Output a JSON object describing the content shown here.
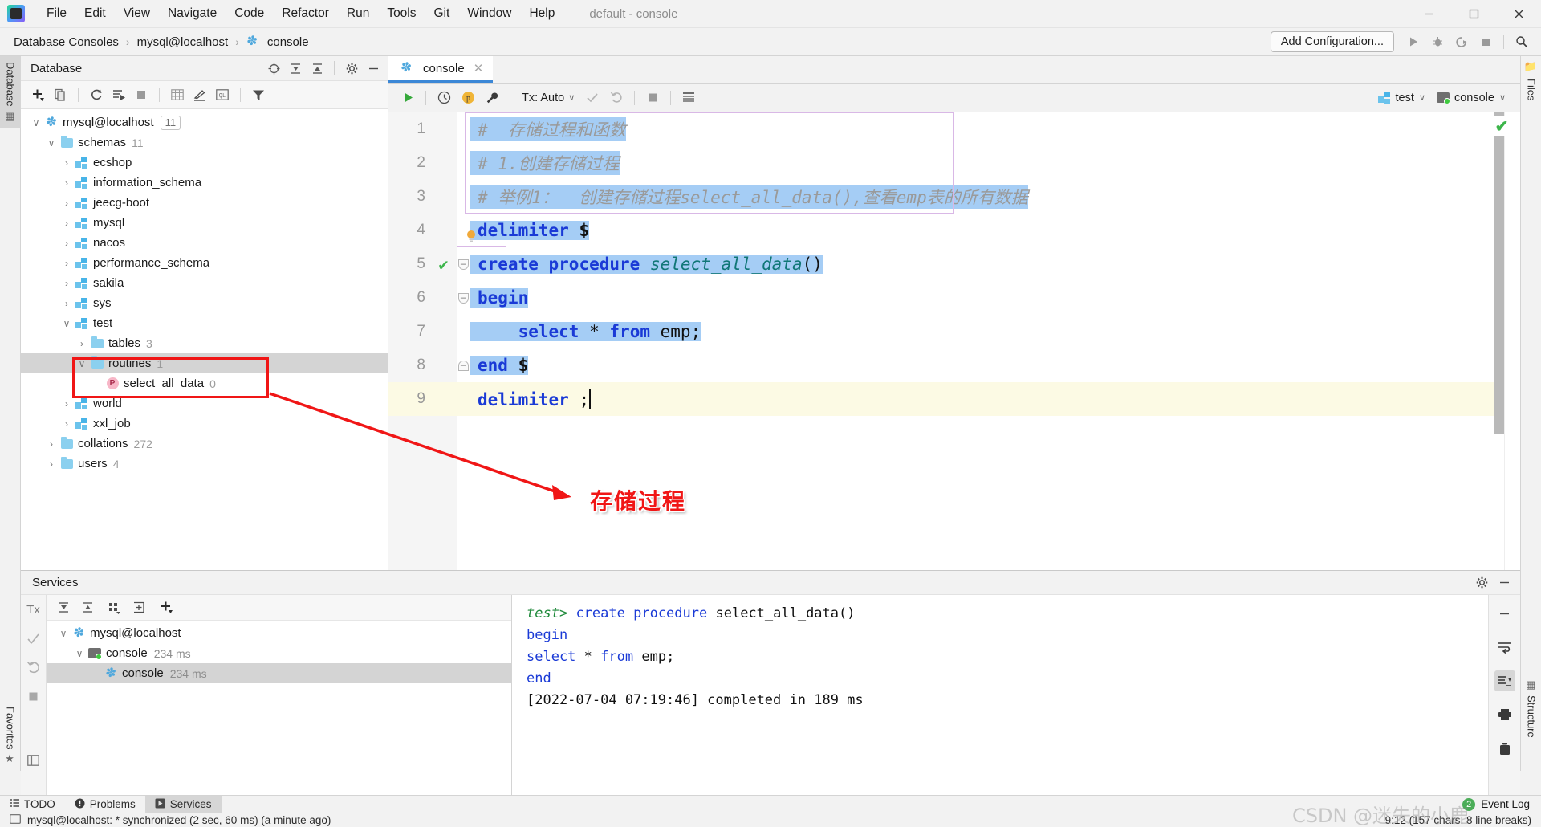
{
  "titlebar": {
    "app_icon": "datagrip-logo",
    "menus": [
      "File",
      "Edit",
      "View",
      "Navigate",
      "Code",
      "Refactor",
      "Run",
      "Tools",
      "Git",
      "Window",
      "Help"
    ],
    "window_title": "default - console",
    "minimize": "─",
    "maximize": "❐",
    "close": "✕"
  },
  "navbar": {
    "breadcrumbs": [
      "Database Consoles",
      "mysql@localhost",
      "console"
    ],
    "separator": "›",
    "add_configuration": "Add Configuration...",
    "icons": [
      "run-icon",
      "debug-icon",
      "run-with-coverage-icon",
      "stop-icon",
      "search-everywhere-icon"
    ]
  },
  "left_rail": {
    "database_tab": "Database",
    "favorites_tab": "Favorites"
  },
  "right_rail": {
    "files_tab": "Files",
    "structure_tab": "Structure"
  },
  "database_panel": {
    "title": "Database",
    "header_icons": [
      "sync-pointer-icon",
      "expand-all-icon",
      "collapse-all-icon",
      "gear-icon",
      "hide-icon"
    ],
    "toolbar_icons": [
      "add-icon",
      "copy-icon",
      "refresh-icon",
      "run-script-icon",
      "stop-icon",
      "table-editor-icon",
      "modify-icon",
      "query-console-icon",
      "filter-icon"
    ],
    "tree": [
      {
        "level": 0,
        "twisty": "∨",
        "icon": "mysql-connection-icon",
        "label": "mysql@localhost",
        "badge": "11"
      },
      {
        "level": 1,
        "twisty": "∨",
        "icon": "folder-icon",
        "label": "schemas",
        "count": "11"
      },
      {
        "level": 2,
        "twisty": "›",
        "icon": "schema-icon",
        "label": "ecshop",
        "count": ""
      },
      {
        "level": 2,
        "twisty": "›",
        "icon": "schema-icon",
        "label": "information_schema",
        "count": ""
      },
      {
        "level": 2,
        "twisty": "›",
        "icon": "schema-icon",
        "label": "jeecg-boot",
        "count": ""
      },
      {
        "level": 2,
        "twisty": "›",
        "icon": "schema-icon",
        "label": "mysql",
        "count": ""
      },
      {
        "level": 2,
        "twisty": "›",
        "icon": "schema-icon",
        "label": "nacos",
        "count": ""
      },
      {
        "level": 2,
        "twisty": "›",
        "icon": "schema-icon",
        "label": "performance_schema",
        "count": ""
      },
      {
        "level": 2,
        "twisty": "›",
        "icon": "schema-icon",
        "label": "sakila",
        "count": ""
      },
      {
        "level": 2,
        "twisty": "›",
        "icon": "schema-icon",
        "label": "sys",
        "count": ""
      },
      {
        "level": 2,
        "twisty": "∨",
        "icon": "schema-icon",
        "label": "test",
        "count": ""
      },
      {
        "level": 3,
        "twisty": "›",
        "icon": "folder-icon",
        "label": "tables",
        "count": "3"
      },
      {
        "level": 3,
        "twisty": "∨",
        "icon": "folder-icon",
        "label": "routines",
        "count": "1",
        "selected": true
      },
      {
        "level": 4,
        "twisty": "",
        "icon": "procedure-icon",
        "label": "select_all_data",
        "count": "0"
      },
      {
        "level": 2,
        "twisty": "›",
        "icon": "schema-icon",
        "label": "world",
        "count": ""
      },
      {
        "level": 2,
        "twisty": "›",
        "icon": "schema-icon",
        "label": "xxl_job",
        "count": ""
      },
      {
        "level": 1,
        "twisty": "›",
        "icon": "folder-icon",
        "label": "collations",
        "count": "272"
      },
      {
        "level": 1,
        "twisty": "›",
        "icon": "folder-icon",
        "label": "users",
        "count": "4"
      }
    ]
  },
  "annotation": {
    "box_color": "#f01616",
    "arrow_color": "#f01616",
    "label": "存储过程"
  },
  "editor": {
    "tab_label": "console",
    "tab_icon": "mysql-console-icon",
    "tab_close": "✕",
    "toolbar": {
      "execute": "run-icon",
      "history": "history-icon",
      "parameters": "parameters-icon",
      "settings": "wrench-icon",
      "tx_label": "Tx: Auto",
      "tx_chevron": "∨",
      "commit": "commit-icon",
      "rollback": "rollback-icon",
      "stop": "stop-icon",
      "data_source_icon": "table-icon",
      "schema_chip": "test",
      "schema_icon": "schema-icon",
      "session_chip": "console",
      "session_icon": "console-icon",
      "chevron": "∨"
    },
    "ok_badge": "✔",
    "lines": [
      {
        "no": "1",
        "type": "comment",
        "text": "#  存储过程和函数",
        "selected": true
      },
      {
        "no": "2",
        "type": "comment",
        "text": "# 1.创建存储过程",
        "selected": true
      },
      {
        "no": "3",
        "type": "comment",
        "text": "# 举例1：  创建存储过程select_all_data(),查看emp表的所有数据",
        "selected": true
      },
      {
        "no": "4",
        "type": "code",
        "text": "delimiter $",
        "selected": true
      },
      {
        "no": "5",
        "type": "code",
        "text": "create procedure select_all_data()",
        "selected": true,
        "gutter": "check",
        "fold": "down"
      },
      {
        "no": "6",
        "type": "code",
        "text": "begin",
        "selected": true,
        "fold": "down"
      },
      {
        "no": "7",
        "type": "code",
        "text": "    select * from emp;",
        "selected": true
      },
      {
        "no": "8",
        "type": "code",
        "text": "end $",
        "selected": true,
        "fold": "up"
      },
      {
        "no": "9",
        "type": "code",
        "text": "delimiter ;",
        "selected": false,
        "current": true
      }
    ]
  },
  "services": {
    "title": "Services",
    "header_icons": [
      "gear-icon",
      "hide-icon"
    ],
    "rail_icons": [
      "tx-icon",
      "commit-icon",
      "rollback-icon",
      "stop-icon",
      "layout-icon"
    ],
    "toolbar_icons": [
      "expand-all-icon",
      "collapse-all-icon",
      "group-icon",
      "add-tab-icon",
      "add-icon"
    ],
    "tree": [
      {
        "level": 0,
        "twisty": "∨",
        "icon": "mysql-connection-icon",
        "label": "mysql@localhost",
        "time": ""
      },
      {
        "level": 1,
        "twisty": "∨",
        "icon": "console-icon",
        "label": "console",
        "time": "234 ms"
      },
      {
        "level": 2,
        "twisty": "",
        "icon": "mysql-console-icon",
        "label": "console",
        "time": "234 ms",
        "selected": true
      }
    ],
    "output": [
      {
        "prompt": "test>",
        "code": "create procedure select_all_data()"
      },
      {
        "prompt": "",
        "code": "     begin"
      },
      {
        "prompt": "",
        "code": "         select * from emp;"
      },
      {
        "prompt": "",
        "code": "     end"
      },
      {
        "prompt": "",
        "code": "[2022-07-04 07:19:46] completed in 189 ms",
        "plain": true
      }
    ],
    "output_rail_icons": [
      "soft-wrap-icon",
      "scroll-to-end-icon",
      "print-icon",
      "clear-all-icon"
    ]
  },
  "bottom_bar": {
    "tools": [
      {
        "label": "TODO",
        "icon": "todo-icon",
        "active": false
      },
      {
        "label": "Problems",
        "icon": "problems-icon",
        "active": false
      },
      {
        "label": "Services",
        "icon": "services-icon",
        "active": true
      }
    ],
    "event_log": "Event Log",
    "event_badge": "2"
  },
  "statusbar": {
    "left": "mysql@localhost: * synchronized (2 sec, 60 ms) (a minute ago)",
    "left_icon": "console-icon",
    "right": "9:12 (157 chars, 8 line breaks)"
  },
  "watermark": "CSDN @迷失的小鹿"
}
